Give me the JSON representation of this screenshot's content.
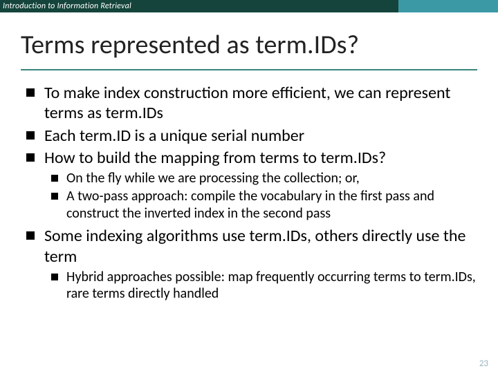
{
  "header": {
    "course": "Introduction to Information Retrieval"
  },
  "title": "Terms represented as term.IDs?",
  "bullets": {
    "b1": "To make index construction more efficient, we can represent terms as term.IDs",
    "b2": "Each term.ID is a unique serial number",
    "b3": "How to build the mapping from terms to term.IDs?",
    "b3_1": "On the fly while we are processing the collection; or,",
    "b3_2": "A two-pass approach: compile the vocabulary in the first pass and construct the inverted index in the second pass",
    "b4": "Some indexing algorithms use term.IDs, others directly use the term",
    "b4_1": "Hybrid approaches possible: map frequently occurring terms to term.IDs, rare terms directly handled"
  },
  "page": "23"
}
